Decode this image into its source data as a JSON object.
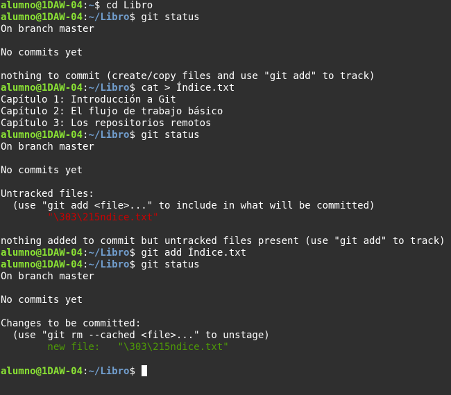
{
  "prompt": {
    "user_host": "alumno@1DAW-04",
    "colon": ":",
    "home": "~",
    "dir": "/Libro",
    "dollar": "$ "
  },
  "colors": {
    "background": "#2f2f2f",
    "prompt_user": "#8ae234",
    "prompt_path": "#729fcf",
    "untracked": "#cc0000",
    "staged": "#4e9a06"
  },
  "lines": {
    "l1_cmd": "cd Libro",
    "l2_cmd": "git status",
    "l3": "On branch master",
    "l5": "No commits yet",
    "l7": "nothing to commit (create/copy files and use \"git add\" to track)",
    "l8_cmd": "cat > Índice.txt",
    "l9": "Capítulo 1: Introducción a Git",
    "l10": "Capítulo 2: El flujo de trabajo básico",
    "l11": "Capítulo 3: Los repositorios remotos",
    "l12_cmd": "git status",
    "l13": "On branch master",
    "l15": "No commits yet",
    "l17": "Untracked files:",
    "l18": "  (use \"git add <file>...\" to include in what will be committed)",
    "l19": "        \"\\303\\215ndice.txt\"",
    "l21": "nothing added to commit but untracked files present (use \"git add\" to track)",
    "l22_cmd": "git add Índice.txt",
    "l23_cmd": "git status",
    "l24": "On branch master",
    "l26": "No commits yet",
    "l28": "Changes to be committed:",
    "l29": "  (use \"git rm --cached <file>...\" to unstage)",
    "l30": "        new file:   \"\\303\\215ndice.txt\""
  }
}
